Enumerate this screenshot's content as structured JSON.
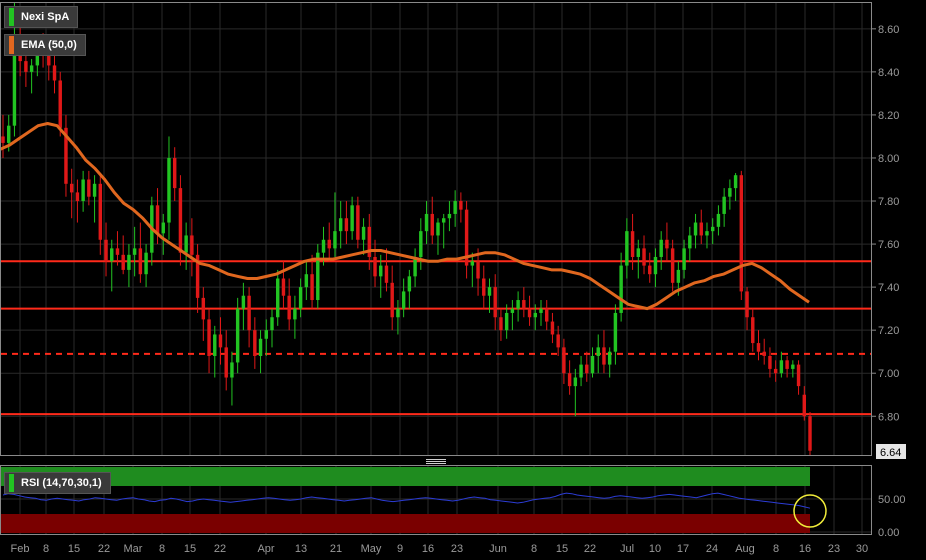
{
  "chart_data": [
    {
      "type": "candlestick",
      "series": [
        {
          "name": "Nexi SpA",
          "color": "#22c422"
        },
        {
          "name": "EMA (50,0)",
          "color": "#e0671f"
        }
      ],
      "y_ticks": [
        "8.60",
        "8.40",
        "8.20",
        "8.00",
        "7.80",
        "7.60",
        "7.40",
        "7.20",
        "7.00",
        "6.80"
      ],
      "ylim": [
        6.62,
        8.72
      ],
      "last_price": "6.64",
      "x_ticks": [
        "Feb",
        "8",
        "15",
        "22",
        "Mar",
        "8",
        "15",
        "22",
        "Apr",
        "13",
        "21",
        "May",
        "9",
        "16",
        "23",
        "Jun",
        "8",
        "15",
        "22",
        "Jul",
        "10",
        "17",
        "24",
        "Aug",
        "8",
        "16",
        "23",
        "30"
      ],
      "horizontal_levels": [
        {
          "value": 7.52,
          "style": "solid",
          "color": "#ff2a1a"
        },
        {
          "value": 7.3,
          "style": "solid",
          "color": "#ff2a1a"
        },
        {
          "value": 7.09,
          "style": "dashed",
          "color": "#ff2a1a"
        },
        {
          "value": 6.81,
          "style": "solid",
          "color": "#ff2a1a"
        }
      ],
      "candles": [
        [
          8.1,
          8.2,
          8.0,
          8.07
        ],
        [
          8.07,
          8.2,
          8.03,
          8.15
        ],
        [
          8.15,
          8.72,
          8.1,
          8.55
        ],
        [
          8.55,
          8.62,
          8.38,
          8.45
        ],
        [
          8.45,
          8.5,
          8.33,
          8.4
        ],
        [
          8.4,
          8.46,
          8.3,
          8.43
        ],
        [
          8.43,
          8.56,
          8.38,
          8.5
        ],
        [
          8.5,
          8.58,
          8.42,
          8.48
        ],
        [
          8.48,
          8.55,
          8.36,
          8.43
        ],
        [
          8.43,
          8.48,
          8.3,
          8.36
        ],
        [
          8.36,
          8.4,
          8.1,
          8.14
        ],
        [
          8.14,
          8.2,
          7.82,
          7.88
        ],
        [
          7.88,
          7.95,
          7.72,
          7.84
        ],
        [
          7.84,
          7.9,
          7.7,
          7.8
        ],
        [
          7.8,
          7.94,
          7.75,
          7.9
        ],
        [
          7.9,
          7.94,
          7.78,
          7.82
        ],
        [
          7.82,
          7.92,
          7.7,
          7.88
        ],
        [
          7.88,
          7.92,
          7.55,
          7.62
        ],
        [
          7.62,
          7.7,
          7.45,
          7.52
        ],
        [
          7.52,
          7.62,
          7.38,
          7.58
        ],
        [
          7.58,
          7.66,
          7.5,
          7.55
        ],
        [
          7.55,
          7.64,
          7.46,
          7.48
        ],
        [
          7.48,
          7.6,
          7.4,
          7.55
        ],
        [
          7.55,
          7.68,
          7.45,
          7.58
        ],
        [
          7.58,
          7.7,
          7.42,
          7.46
        ],
        [
          7.46,
          7.6,
          7.4,
          7.56
        ],
        [
          7.56,
          7.82,
          7.5,
          7.78
        ],
        [
          7.78,
          7.86,
          7.6,
          7.65
        ],
        [
          7.65,
          7.74,
          7.55,
          7.7
        ],
        [
          7.7,
          8.1,
          7.62,
          8.0
        ],
        [
          8.0,
          8.05,
          7.8,
          7.86
        ],
        [
          7.86,
          7.92,
          7.5,
          7.56
        ],
        [
          7.56,
          7.7,
          7.48,
          7.64
        ],
        [
          7.64,
          7.72,
          7.45,
          7.55
        ],
        [
          7.55,
          7.6,
          7.28,
          7.35
        ],
        [
          7.35,
          7.4,
          7.15,
          7.25
        ],
        [
          7.25,
          7.3,
          7.0,
          7.08
        ],
        [
          7.08,
          7.22,
          6.98,
          7.18
        ],
        [
          7.18,
          7.26,
          7.04,
          7.12
        ],
        [
          7.12,
          7.2,
          6.92,
          6.98
        ],
        [
          6.98,
          7.1,
          6.85,
          7.05
        ],
        [
          7.05,
          7.35,
          7.0,
          7.3
        ],
        [
          7.3,
          7.42,
          7.2,
          7.36
        ],
        [
          7.36,
          7.4,
          7.12,
          7.2
        ],
        [
          7.2,
          7.26,
          7.02,
          7.08
        ],
        [
          7.08,
          7.2,
          7.0,
          7.16
        ],
        [
          7.16,
          7.25,
          7.08,
          7.2
        ],
        [
          7.2,
          7.3,
          7.12,
          7.26
        ],
        [
          7.26,
          7.48,
          7.22,
          7.44
        ],
        [
          7.44,
          7.52,
          7.3,
          7.36
        ],
        [
          7.36,
          7.44,
          7.2,
          7.25
        ],
        [
          7.25,
          7.36,
          7.16,
          7.3
        ],
        [
          7.3,
          7.44,
          7.26,
          7.4
        ],
        [
          7.4,
          7.52,
          7.34,
          7.46
        ],
        [
          7.46,
          7.55,
          7.3,
          7.34
        ],
        [
          7.34,
          7.6,
          7.3,
          7.56
        ],
        [
          7.56,
          7.68,
          7.5,
          7.62
        ],
        [
          7.62,
          7.7,
          7.52,
          7.58
        ],
        [
          7.58,
          7.84,
          7.54,
          7.66
        ],
        [
          7.66,
          7.8,
          7.58,
          7.72
        ],
        [
          7.72,
          7.8,
          7.6,
          7.66
        ],
        [
          7.66,
          7.82,
          7.62,
          7.78
        ],
        [
          7.78,
          7.82,
          7.58,
          7.62
        ],
        [
          7.62,
          7.72,
          7.55,
          7.68
        ],
        [
          7.68,
          7.74,
          7.48,
          7.54
        ],
        [
          7.54,
          7.62,
          7.4,
          7.45
        ],
        [
          7.45,
          7.55,
          7.35,
          7.5
        ],
        [
          7.5,
          7.58,
          7.38,
          7.42
        ],
        [
          7.42,
          7.5,
          7.2,
          7.26
        ],
        [
          7.26,
          7.34,
          7.18,
          7.3
        ],
        [
          7.3,
          7.44,
          7.26,
          7.38
        ],
        [
          7.38,
          7.48,
          7.3,
          7.45
        ],
        [
          7.45,
          7.58,
          7.4,
          7.54
        ],
        [
          7.54,
          7.72,
          7.48,
          7.66
        ],
        [
          7.66,
          7.8,
          7.6,
          7.74
        ],
        [
          7.74,
          7.82,
          7.6,
          7.64
        ],
        [
          7.64,
          7.72,
          7.55,
          7.7
        ],
        [
          7.7,
          7.74,
          7.58,
          7.72
        ],
        [
          7.72,
          7.8,
          7.66,
          7.74
        ],
        [
          7.74,
          7.85,
          7.68,
          7.8
        ],
        [
          7.8,
          7.84,
          7.7,
          7.76
        ],
        [
          7.76,
          7.8,
          7.44,
          7.5
        ],
        [
          7.5,
          7.56,
          7.4,
          7.52
        ],
        [
          7.52,
          7.58,
          7.36,
          7.44
        ],
        [
          7.44,
          7.5,
          7.3,
          7.36
        ],
        [
          7.36,
          7.44,
          7.28,
          7.4
        ],
        [
          7.4,
          7.46,
          7.2,
          7.26
        ],
        [
          7.26,
          7.3,
          7.15,
          7.2
        ],
        [
          7.2,
          7.32,
          7.16,
          7.28
        ],
        [
          7.28,
          7.34,
          7.2,
          7.3
        ],
        [
          7.3,
          7.38,
          7.24,
          7.34
        ],
        [
          7.34,
          7.4,
          7.26,
          7.3
        ],
        [
          7.3,
          7.36,
          7.22,
          7.26
        ],
        [
          7.26,
          7.32,
          7.2,
          7.28
        ],
        [
          7.28,
          7.34,
          7.22,
          7.3
        ],
        [
          7.3,
          7.34,
          7.2,
          7.24
        ],
        [
          7.24,
          7.28,
          7.14,
          7.18
        ],
        [
          7.18,
          7.22,
          7.08,
          7.12
        ],
        [
          7.12,
          7.16,
          6.95,
          7.0
        ],
        [
          7.0,
          7.06,
          6.9,
          6.94
        ],
        [
          6.94,
          7.02,
          6.8,
          6.98
        ],
        [
          6.98,
          7.08,
          6.94,
          7.04
        ],
        [
          7.04,
          7.1,
          6.96,
          7.0
        ],
        [
          7.0,
          7.12,
          6.98,
          7.08
        ],
        [
          7.08,
          7.18,
          7.0,
          7.12
        ],
        [
          7.12,
          7.2,
          7.0,
          7.04
        ],
        [
          7.04,
          7.12,
          6.98,
          7.1
        ],
        [
          7.1,
          7.32,
          7.04,
          7.28
        ],
        [
          7.28,
          7.56,
          7.24,
          7.5
        ],
        [
          7.5,
          7.72,
          7.44,
          7.66
        ],
        [
          7.66,
          7.74,
          7.48,
          7.54
        ],
        [
          7.54,
          7.62,
          7.44,
          7.58
        ],
        [
          7.58,
          7.64,
          7.46,
          7.5
        ],
        [
          7.5,
          7.56,
          7.42,
          7.46
        ],
        [
          7.46,
          7.58,
          7.4,
          7.54
        ],
        [
          7.54,
          7.66,
          7.48,
          7.62
        ],
        [
          7.62,
          7.7,
          7.52,
          7.58
        ],
        [
          7.58,
          7.62,
          7.38,
          7.42
        ],
        [
          7.42,
          7.52,
          7.36,
          7.48
        ],
        [
          7.48,
          7.62,
          7.44,
          7.58
        ],
        [
          7.58,
          7.68,
          7.52,
          7.64
        ],
        [
          7.64,
          7.74,
          7.58,
          7.7
        ],
        [
          7.7,
          7.76,
          7.6,
          7.64
        ],
        [
          7.64,
          7.7,
          7.58,
          7.66
        ],
        [
          7.66,
          7.72,
          7.6,
          7.68
        ],
        [
          7.68,
          7.78,
          7.64,
          7.74
        ],
        [
          7.74,
          7.86,
          7.68,
          7.82
        ],
        [
          7.82,
          7.9,
          7.76,
          7.86
        ],
        [
          7.86,
          7.93,
          7.8,
          7.92
        ],
        [
          7.92,
          7.94,
          7.34,
          7.38
        ],
        [
          7.38,
          7.4,
          7.2,
          7.26
        ],
        [
          7.26,
          7.3,
          7.1,
          7.14
        ],
        [
          7.14,
          7.2,
          7.06,
          7.1
        ],
        [
          7.1,
          7.16,
          7.04,
          7.08
        ],
        [
          7.08,
          7.12,
          6.98,
          7.02
        ],
        [
          7.02,
          7.06,
          6.96,
          7.0
        ],
        [
          7.0,
          7.1,
          6.98,
          7.06
        ],
        [
          7.06,
          7.08,
          6.98,
          7.02
        ],
        [
          7.02,
          7.06,
          6.98,
          7.04
        ],
        [
          7.04,
          7.06,
          6.9,
          6.94
        ],
        [
          6.9,
          6.94,
          6.78,
          6.8
        ],
        [
          6.8,
          6.82,
          6.62,
          6.64
        ]
      ],
      "ema": [
        [
          8.04,
          8.06,
          8.09,
          8.12,
          8.15,
          8.16
        ],
        [
          8.15,
          8.1,
          8.05,
          7.99,
          7.95,
          7.9,
          7.84,
          7.79,
          7.76,
          7.72,
          7.67,
          7.63,
          7.6,
          7.57,
          7.54,
          7.51,
          7.5,
          7.48,
          7.46,
          7.45,
          7.44,
          7.44,
          7.45,
          7.46,
          7.48,
          7.5,
          7.52
        ],
        [
          7.53,
          7.53,
          7.53,
          7.54,
          7.55,
          7.56,
          7.57,
          7.57,
          7.56,
          7.55,
          7.54,
          7.53,
          7.52,
          7.52,
          7.53,
          7.53,
          7.54,
          7.55,
          7.56,
          7.56,
          7.55,
          7.53,
          7.51,
          7.5,
          7.49,
          7.48,
          7.48,
          7.47,
          7.46,
          7.44,
          7.41,
          7.38,
          7.35,
          7.32,
          7.31,
          7.3,
          7.32,
          7.35,
          7.38,
          7.4,
          7.42,
          7.43,
          7.45,
          7.46,
          7.48,
          7.5,
          7.51,
          7.49,
          7.46,
          7.43,
          7.39,
          7.36,
          7.33
        ]
      ]
    },
    {
      "type": "line",
      "title": "RSI (14,70,30,1)",
      "series": [
        {
          "name": "RSI (14,70,30,1)",
          "color": "#2c3cd6"
        }
      ],
      "y_ticks": [
        "50.00",
        "0.00"
      ],
      "overbought_zone_color": "#1f8c1f",
      "oversold_zone_color": "#7a0000",
      "values": [
        56,
        58,
        57,
        55,
        53,
        52,
        51,
        49,
        48,
        50,
        51,
        50,
        49,
        48,
        47,
        49,
        50,
        52,
        51,
        50,
        49,
        48,
        50,
        51,
        52,
        50,
        49,
        47,
        46,
        48,
        49,
        51,
        50,
        48,
        46,
        47,
        49,
        50,
        49,
        48,
        47,
        46,
        45,
        46,
        47,
        48,
        49,
        50,
        51,
        52,
        51,
        50,
        49,
        48,
        49,
        50,
        52,
        53,
        52,
        51,
        50,
        49,
        48,
        47,
        48,
        49,
        50,
        51,
        52,
        50,
        48,
        47,
        46,
        47,
        48,
        49,
        50,
        51,
        52,
        51,
        50,
        49,
        48,
        47,
        48,
        50,
        52,
        53,
        52,
        51,
        49,
        48,
        47,
        46,
        45,
        44,
        45,
        47,
        49,
        50,
        51,
        52,
        54,
        57,
        59,
        58,
        56,
        55,
        54,
        53,
        52,
        51,
        52,
        54,
        55,
        54,
        53,
        52,
        51,
        52,
        53,
        55,
        56,
        57,
        56,
        55,
        54,
        53,
        52,
        54,
        56,
        58,
        59,
        57,
        55,
        53,
        51,
        50,
        49,
        48,
        47,
        46,
        45,
        44,
        43,
        42,
        41,
        40,
        38,
        36
      ]
    }
  ]
}
